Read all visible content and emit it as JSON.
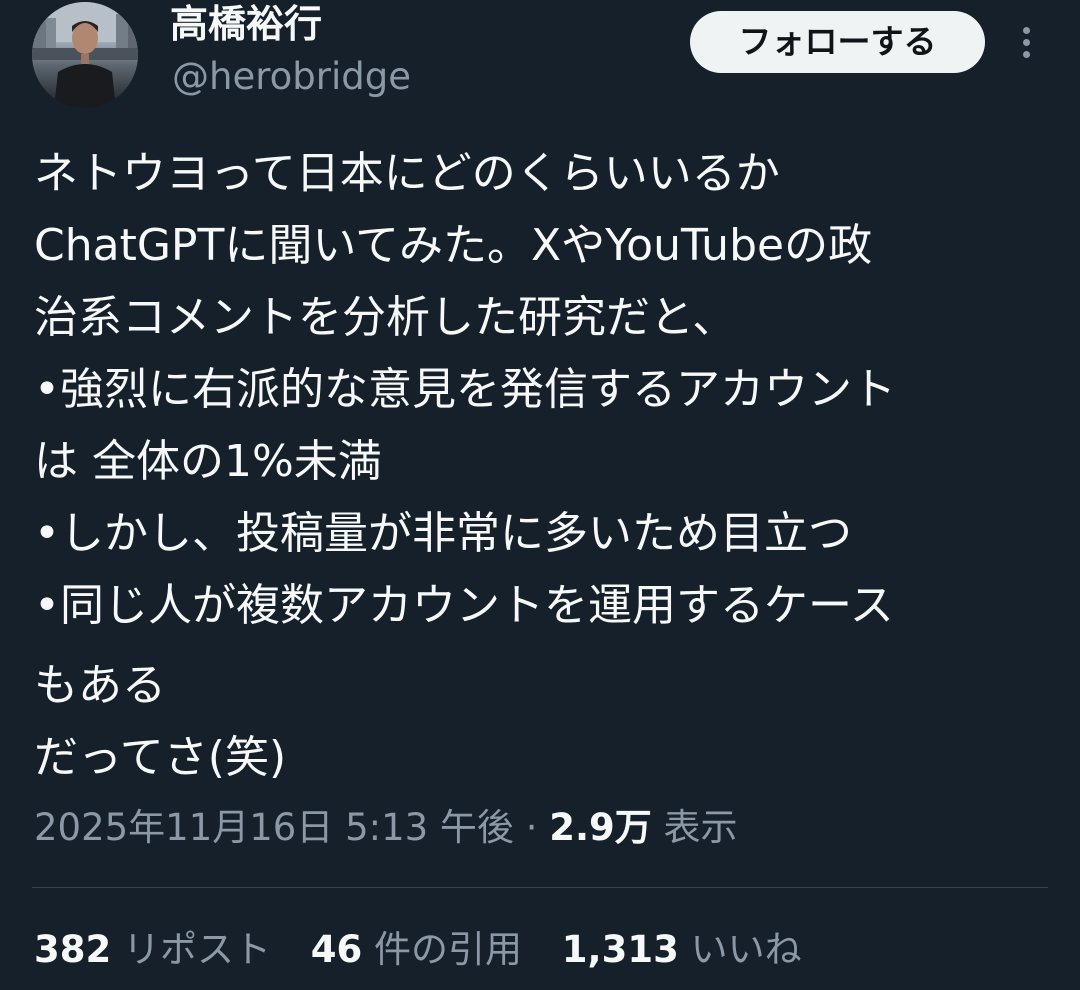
{
  "author": {
    "display_name": "高橋裕行",
    "handle": "@herobridge"
  },
  "actions": {
    "follow_label": "フォローする",
    "more_icon": "more-vertical-icon"
  },
  "tweet": {
    "lines": [
      "ネトウヨって日本にどのくらいいるか",
      "ChatGPTに聞いてみた。XやYouTubeの政",
      "治系コメントを分析した研究だと、",
      "•強烈に右派的な意見を発信するアカウント",
      "は 全体の1%未満",
      "•しかし、投稿量が非常に多いため目立つ",
      "•同じ人が複数アカウントを運用するケース",
      "もある",
      "だってさ(笑)"
    ]
  },
  "meta": {
    "timestamp": "2025年11月16日 5:13 午後",
    "separator": "·",
    "views_count": "2.9万",
    "views_label": "表示"
  },
  "stats": {
    "reposts_count": "382",
    "reposts_label": "リポスト",
    "quotes_count": "46",
    "quotes_label": "件の引用",
    "likes_count": "1,313",
    "likes_label": "いいね"
  },
  "colors": {
    "background": "#15202b",
    "text_primary": "#f7f9f9",
    "text_secondary": "#8b98a5",
    "follow_button_bg": "#eff3f4",
    "divider": "#38444d"
  }
}
